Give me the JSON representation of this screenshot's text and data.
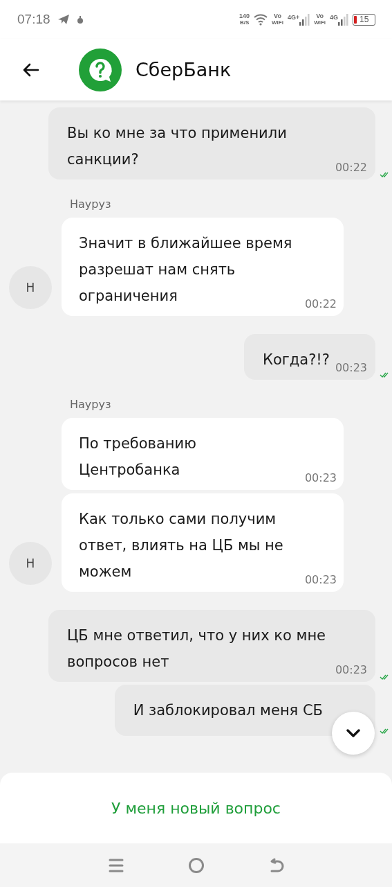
{
  "status_bar": {
    "time": "07:18",
    "speed_value": "140",
    "speed_unit": "B/S",
    "sims": [
      {
        "vo": "Vo",
        "wifi": "WiFi",
        "network": "4G+"
      },
      {
        "vo": "Vo",
        "wifi": "WiFi",
        "network": "4G"
      }
    ],
    "battery": "15"
  },
  "header": {
    "title": "СберБанк"
  },
  "messages": [
    {
      "kind": "outgoing",
      "text": "Вы ко мне за что применили санкции?",
      "time": "00:22",
      "read": true
    },
    {
      "kind": "incoming",
      "sender": "Науруз",
      "avatar": "Н",
      "messages": [
        {
          "text": "Значит в ближайшее время разрешат нам снять ограничения",
          "time": "00:22"
        }
      ]
    },
    {
      "kind": "outgoing",
      "text": "Когда?!?",
      "time": "00:23",
      "read": true
    },
    {
      "kind": "incoming",
      "sender": "Науруз",
      "avatar": "Н",
      "messages": [
        {
          "text": "По требованию Центробанка",
          "time": "00:23"
        },
        {
          "text": "Как только сами получим ответ, влиять на ЦБ мы не можем",
          "time": "00:23"
        }
      ]
    },
    {
      "kind": "outgoing",
      "text": "ЦБ мне ответил, что у них ко мне вопросов нет",
      "time": "00:23",
      "read": true
    },
    {
      "kind": "outgoing",
      "text": "И заблокировал меня СБ",
      "read": true
    }
  ],
  "action_button": {
    "label": "У меня новый вопрос"
  }
}
